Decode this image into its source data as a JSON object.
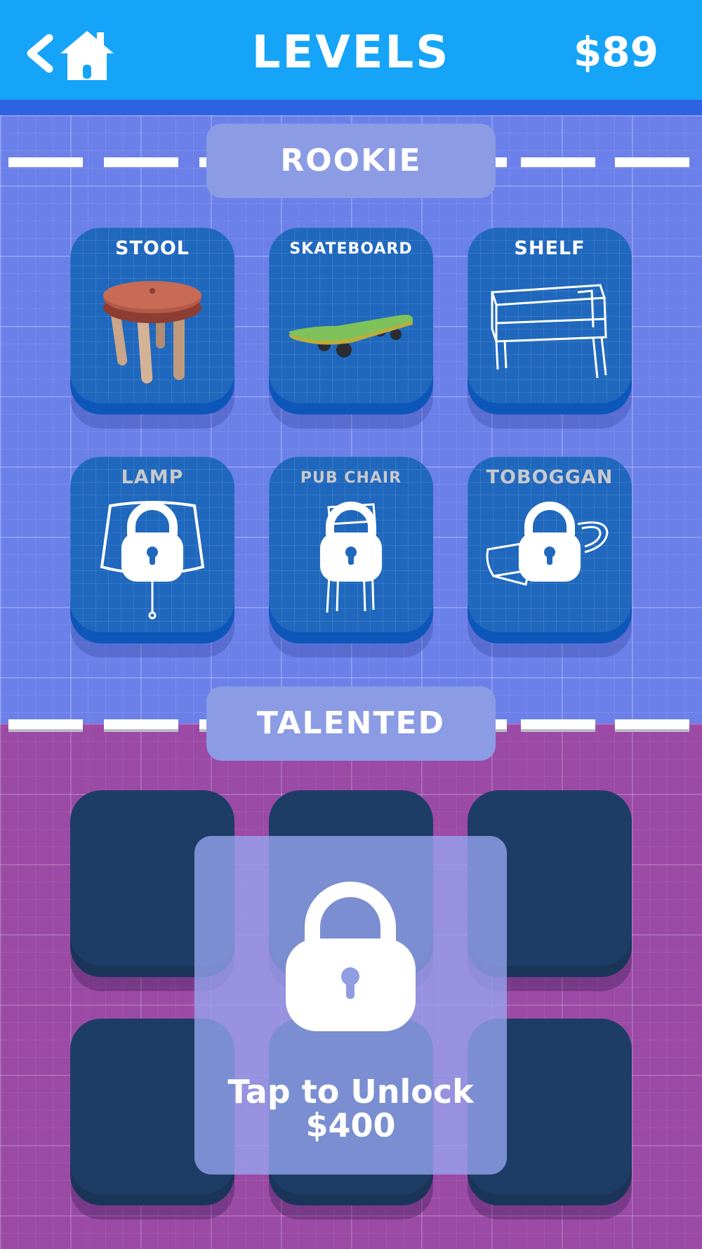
{
  "header": {
    "title": "LEVELS",
    "money": "$89"
  },
  "sections": [
    {
      "label": "ROOKIE",
      "levels": [
        {
          "name": "STOOL",
          "locked": false
        },
        {
          "name": "SKATEBOARD",
          "locked": false
        },
        {
          "name": "SHELF",
          "locked": false
        },
        {
          "name": "LAMP",
          "locked": true
        },
        {
          "name": "PUB CHAIR",
          "locked": true
        },
        {
          "name": "TOBOGGAN",
          "locked": true
        }
      ]
    },
    {
      "label": "TALENTED",
      "locked": true,
      "unlock_text": "Tap to Unlock",
      "unlock_price": "$400"
    }
  ],
  "colors": {
    "topbar": "#15a4f8",
    "rookie_bg": "#6c80ea",
    "talented_bg": "#9b4aa6",
    "tile_blue": "#1f68bd",
    "tile_navy": "#1e3d66"
  },
  "icons": [
    "back-arrow-icon",
    "home-icon",
    "lock-icon"
  ]
}
